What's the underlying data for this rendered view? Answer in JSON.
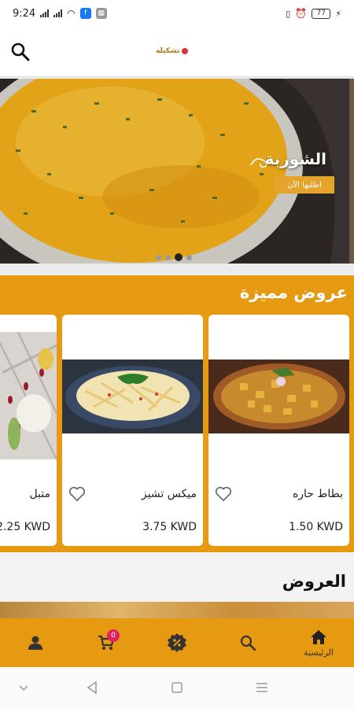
{
  "status_bar": {
    "time": "9:24",
    "battery": "77"
  },
  "app_bar": {
    "logo_text": "تشكيلة"
  },
  "hero": {
    "title": "الشوربة",
    "order_button": "اطلبها الآن",
    "slide_count": 4,
    "active_slide": 2
  },
  "featured": {
    "title": "عروض مميزة",
    "items": [
      {
        "name": "بطاط حاره",
        "price": "1.50 KWD"
      },
      {
        "name": "ميكس تشيز",
        "price": "3.75 KWD"
      },
      {
        "name": "متبل",
        "price": "2.25 KWD"
      }
    ]
  },
  "offers": {
    "title": "العروض"
  },
  "bottom_nav": {
    "home_label": "الرئيسية",
    "cart_count": "0"
  },
  "colors": {
    "accent": "#e59a12",
    "button": "#e4a32a",
    "badge": "#e0245e"
  }
}
